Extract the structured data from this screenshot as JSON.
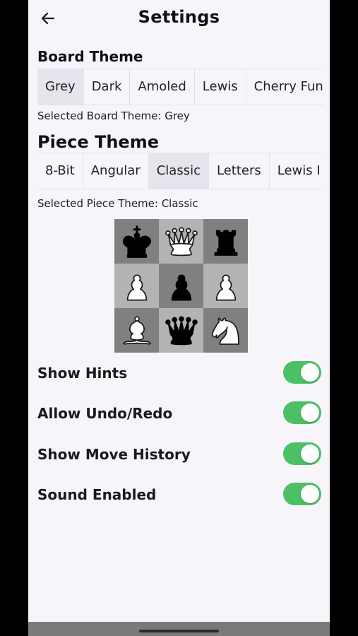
{
  "header": {
    "title": "Settings",
    "back_icon": "arrow-left-icon"
  },
  "board_theme": {
    "heading": "Board Theme",
    "options": [
      "Grey",
      "Dark",
      "Amoled",
      "Lewis",
      "Cherry Funk"
    ],
    "selected": "Grey",
    "selected_text": "Selected Board Theme: Grey"
  },
  "piece_theme": {
    "heading": "Piece Theme",
    "options": [
      "8-Bit",
      "Angular",
      "Classic",
      "Letters",
      "Lewis I"
    ],
    "selected": "Classic",
    "selected_text": "Selected Piece Theme: Classic"
  },
  "preview": {
    "light_color": "#b3b3b3",
    "dark_color": "#808080",
    "squares": [
      {
        "piece": "king",
        "color": "black"
      },
      {
        "piece": "queen",
        "color": "white"
      },
      {
        "piece": "rook",
        "color": "black"
      },
      {
        "piece": "pawn",
        "color": "white"
      },
      {
        "piece": "pawn",
        "color": "black"
      },
      {
        "piece": "pawn",
        "color": "white"
      },
      {
        "piece": "bishop",
        "color": "white"
      },
      {
        "piece": "queen",
        "color": "black"
      },
      {
        "piece": "knight",
        "color": "white"
      }
    ]
  },
  "toggles": [
    {
      "label": "Show Hints",
      "on": true
    },
    {
      "label": "Allow Undo/Redo",
      "on": true
    },
    {
      "label": "Show Move History",
      "on": true
    },
    {
      "label": "Sound Enabled",
      "on": true
    }
  ],
  "colors": {
    "accent_green": "#4cc065",
    "background": "#f7f5fa",
    "chip_selected": "#e6e4ec"
  }
}
